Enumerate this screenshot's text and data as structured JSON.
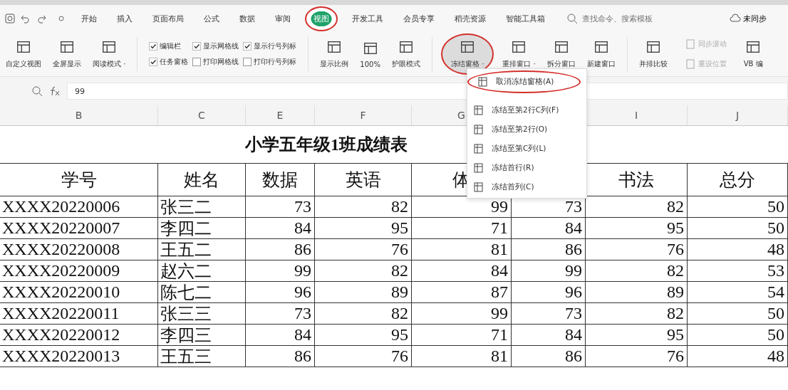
{
  "menu_tabs": [
    {
      "label": "开始",
      "selected": false,
      "circled": false
    },
    {
      "label": "插入",
      "selected": false,
      "circled": false
    },
    {
      "label": "页面布局",
      "selected": false,
      "circled": false
    },
    {
      "label": "公式",
      "selected": false,
      "circled": false
    },
    {
      "label": "数据",
      "selected": false,
      "circled": false
    },
    {
      "label": "审阅",
      "selected": false,
      "circled": false
    },
    {
      "label": "视图",
      "selected": true,
      "circled": true
    },
    {
      "label": "开发工具",
      "selected": false,
      "circled": false
    },
    {
      "label": "会员专享",
      "selected": false,
      "circled": false
    },
    {
      "label": "稻壳资源",
      "selected": false,
      "circled": false
    },
    {
      "label": "智能工具箱",
      "selected": false,
      "circled": false
    }
  ],
  "search": {
    "placeholder": "查找命令、搜索模板"
  },
  "sync": "未同步",
  "ribbon": [
    {
      "kind": "big",
      "label": "自定义视图",
      "pressed": false,
      "circled": false
    },
    {
      "kind": "big",
      "label": "全屏显示",
      "pressed": false,
      "circled": false
    },
    {
      "kind": "big",
      "label": "阅读模式 ·",
      "pressed": false,
      "circled": false
    },
    {
      "kind": "checks",
      "items": [
        {
          "label": "编辑栏",
          "checked": true
        },
        {
          "label": "显示网格线",
          "checked": true
        },
        {
          "label": "显示行号列标",
          "checked": true
        },
        {
          "label": "任务窗格",
          "checked": true
        },
        {
          "label": "打印网格线",
          "checked": false
        },
        {
          "label": "打印行号列标",
          "checked": false
        }
      ]
    },
    {
      "kind": "big",
      "label": "显示比例",
      "pressed": false,
      "circled": false
    },
    {
      "kind": "big",
      "label": "100%",
      "pressed": false,
      "circled": false
    },
    {
      "kind": "big",
      "label": "护眼模式",
      "pressed": false,
      "circled": false
    },
    {
      "kind": "big",
      "label": "冻结窗格 ·",
      "pressed": true,
      "circled": true
    },
    {
      "kind": "big",
      "label": "重排窗口 ·",
      "pressed": false,
      "circled": false
    },
    {
      "kind": "big",
      "label": "拆分窗口",
      "pressed": false,
      "circled": false
    },
    {
      "kind": "big",
      "label": "新建窗口",
      "pressed": false,
      "circled": false
    },
    {
      "kind": "big",
      "label": "并排比较",
      "pressed": false,
      "circled": false
    },
    {
      "kind": "smalls",
      "items": [
        {
          "label": "同步滚动",
          "disabled": true
        },
        {
          "label": "重设位置",
          "disabled": true
        }
      ]
    },
    {
      "kind": "big",
      "label": "VB 编",
      "pressed": false,
      "circled": false
    }
  ],
  "formula_bar": {
    "value": "99"
  },
  "freeze_menu": [
    {
      "label": "取消冻结窗格(A)",
      "circled": true
    },
    {
      "label": "冻结至第2行C列(F)",
      "circled": false
    },
    {
      "label": "冻结至第2行(O)",
      "circled": false
    },
    {
      "label": "冻结至第C列(L)",
      "circled": false
    },
    {
      "label": "冻结首行(R)",
      "circled": false
    },
    {
      "label": "冻结首列(C)",
      "circled": false
    }
  ],
  "sheet": {
    "columns_left": [
      "B",
      "C",
      "E",
      "F",
      "G"
    ],
    "columns_right": [
      "I",
      "J"
    ],
    "title": "小学五年级1班成绩表",
    "header_left": [
      "学号",
      "姓名",
      "数据",
      "英语",
      "体"
    ],
    "header_right": [
      "书法",
      "总分"
    ],
    "rows": [
      [
        "XXXX20220006",
        "张三二",
        "73",
        "82",
        "99",
        "73",
        "82",
        "50"
      ],
      [
        "XXXX20220007",
        "李四二",
        "84",
        "95",
        "71",
        "84",
        "95",
        "50"
      ],
      [
        "XXXX20220008",
        "王五二",
        "86",
        "76",
        "81",
        "86",
        "76",
        "48"
      ],
      [
        "XXXX20220009",
        "赵六二",
        "99",
        "82",
        "84",
        "99",
        "82",
        "53"
      ],
      [
        "XXXX20220010",
        "陈七二",
        "96",
        "89",
        "87",
        "96",
        "89",
        "54"
      ],
      [
        "XXXX20220011",
        "张三三",
        "73",
        "82",
        "99",
        "73",
        "82",
        "50"
      ],
      [
        "XXXX20220012",
        "李四三",
        "84",
        "95",
        "71",
        "84",
        "95",
        "50"
      ],
      [
        "XXXX20220013",
        "王五三",
        "86",
        "76",
        "81",
        "86",
        "76",
        "48"
      ]
    ]
  }
}
